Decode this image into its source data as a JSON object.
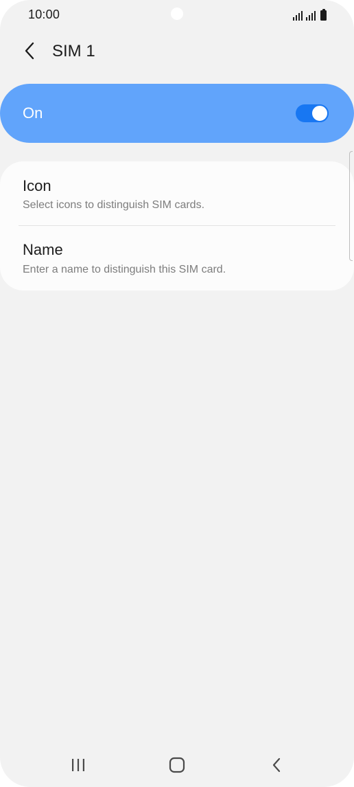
{
  "status_bar": {
    "time": "10:00",
    "icons": [
      "signal-sim1-icon",
      "signal-sim2-icon",
      "battery-icon"
    ]
  },
  "header": {
    "back_icon": "chevron-left-icon",
    "title": "SIM 1"
  },
  "master_switch": {
    "label": "On",
    "checked": true,
    "card_color": "#61a4fb",
    "track_color": "#1877f2"
  },
  "settings": {
    "items": [
      {
        "title": "Icon",
        "subtitle": "Select icons to distinguish SIM cards."
      },
      {
        "title": "Name",
        "subtitle": "Enter a name to distinguish this SIM card."
      }
    ]
  },
  "nav_bar": {
    "buttons": [
      "recent-apps-icon",
      "home-icon",
      "back-icon"
    ]
  },
  "colors": {
    "background": "#f2f2f2",
    "card": "#fcfcfc",
    "text_primary": "#1c1c1c",
    "text_secondary": "#7d7d7d"
  }
}
